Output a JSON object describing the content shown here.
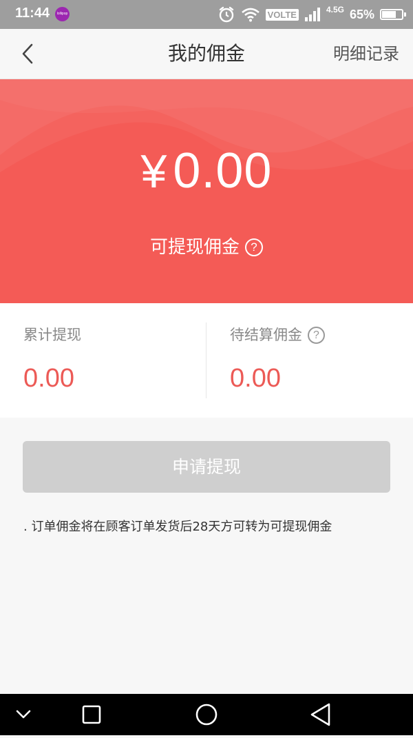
{
  "status_bar": {
    "time": "11:44",
    "app_badge": "lollipop",
    "volte": "VOLTE",
    "network": "4.5G",
    "battery_percent": "65%",
    "battery_level": 0.65,
    "icons": [
      "alarm-icon",
      "wifi-icon",
      "signal-icon",
      "battery-icon"
    ]
  },
  "header": {
    "back_icon": "chevron-left-icon",
    "title": "我的佣金",
    "detail_link": "明细记录"
  },
  "banner": {
    "currency": "¥",
    "amount": "0.00",
    "label": "可提现佣金",
    "help_icon": "question-circle-icon",
    "help_glyph": "?",
    "color": "#f45b56"
  },
  "stats": [
    {
      "label": "累计提现",
      "value": "0.00"
    },
    {
      "label": "待结算佣金",
      "value": "0.00",
      "help_glyph": "?"
    }
  ],
  "apply_button": {
    "label": "申请提现",
    "enabled": false
  },
  "note": ". 订单佣金将在顾客订单发货后28天方可转为可提现佣金",
  "nav_bar": {
    "icons": [
      "collapse-chevron-icon",
      "recents-square-icon",
      "home-circle-icon",
      "back-triangle-icon"
    ]
  },
  "colors": {
    "accent_red": "#f45b56",
    "value_red": "#ec5a56",
    "disabled_button": "#cfcfcf"
  }
}
